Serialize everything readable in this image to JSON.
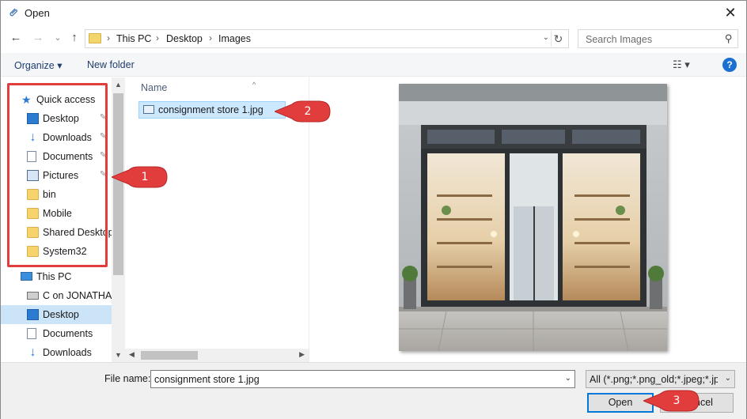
{
  "window": {
    "title": "Open",
    "close_glyph": "✕"
  },
  "nav_buttons": {
    "back": "←",
    "forward": "→",
    "recent": "⌄",
    "up": "↑"
  },
  "address": {
    "crumbs": [
      "This PC",
      "Desktop",
      "Images"
    ],
    "separator": "›",
    "refresh_glyph": "↻",
    "dropdown_glyph": "⌄"
  },
  "search": {
    "placeholder": "Search Images",
    "icon_glyph": "⚲"
  },
  "toolbar": {
    "organize": "Organize ▾",
    "new_folder": "New folder",
    "view": "☷ ▾",
    "help": "?"
  },
  "nav_pane": {
    "items": [
      {
        "label": "Quick access",
        "icon": "star-icon"
      },
      {
        "label": "Desktop",
        "icon": "desktop-icon",
        "pinned": true
      },
      {
        "label": "Downloads",
        "icon": "download-icon",
        "pinned": true
      },
      {
        "label": "Documents",
        "icon": "document-icon",
        "pinned": true
      },
      {
        "label": "Pictures",
        "icon": "pictures-icon",
        "pinned": true
      },
      {
        "label": "bin",
        "icon": "folder-icon"
      },
      {
        "label": "Mobile",
        "icon": "folder-icon"
      },
      {
        "label": "Shared Desktop",
        "icon": "folder-icon"
      },
      {
        "label": "System32",
        "icon": "folder-icon"
      },
      {
        "label": "This PC",
        "icon": "computer-icon"
      },
      {
        "label": "C on JONATHAN",
        "icon": "drive-icon"
      },
      {
        "label": "Desktop",
        "icon": "desktop-icon",
        "selected": true
      },
      {
        "label": "Documents",
        "icon": "document-icon"
      },
      {
        "label": "Downloads",
        "icon": "download-icon"
      }
    ],
    "pin_glyph": "📌"
  },
  "file_list": {
    "column_header": "Name",
    "files": [
      {
        "name": "consignment store 1.jpg",
        "selected": true
      }
    ]
  },
  "bottom": {
    "file_name_label": "File name:",
    "file_name_value": "consignment store 1.jpg",
    "file_type_value": "All (*.png;*.png_old;*.jpeg;*.jpg",
    "open_label": "Open",
    "cancel_label": "ncel"
  },
  "callouts": [
    "1",
    "2",
    "3"
  ],
  "colors": {
    "callout_red": "#e23d3d",
    "accent_blue": "#0078d7",
    "selection": "#cce8ff"
  }
}
